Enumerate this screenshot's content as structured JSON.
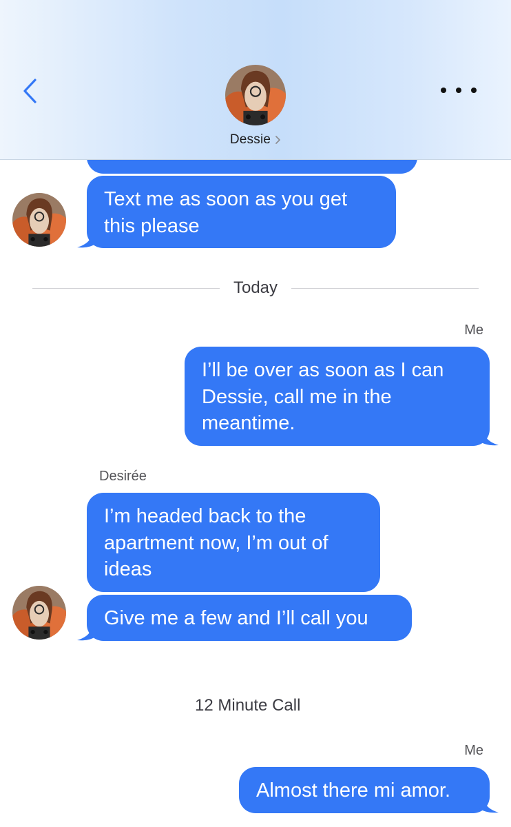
{
  "header": {
    "contact_name": "Dessie",
    "back_icon": "chevron-left-icon",
    "more_icon": "ellipsis-icon",
    "disclosure_icon": "chevron-right-icon"
  },
  "colors": {
    "accent": "#3478f6",
    "incoming_bubble": "#3478f6",
    "outgoing_bubble": "#3478f6",
    "header_tint": "#c6defa"
  },
  "thread": {
    "msg_top_partial": "",
    "msg_1": "Text me as soon as you get this please",
    "date_separator": "Today",
    "sender_me_1": "Me",
    "msg_2": "I’ll be over as soon as I can Dessie, call me in the meantime.",
    "sender_desiree": "Desirée",
    "msg_3": "I’m headed back to the apartment now, I’m out of ideas",
    "msg_4": "Give me a few and I’ll call you",
    "call_event": "12 Minute Call",
    "sender_me_2": "Me",
    "msg_5": "Almost there mi amor."
  }
}
